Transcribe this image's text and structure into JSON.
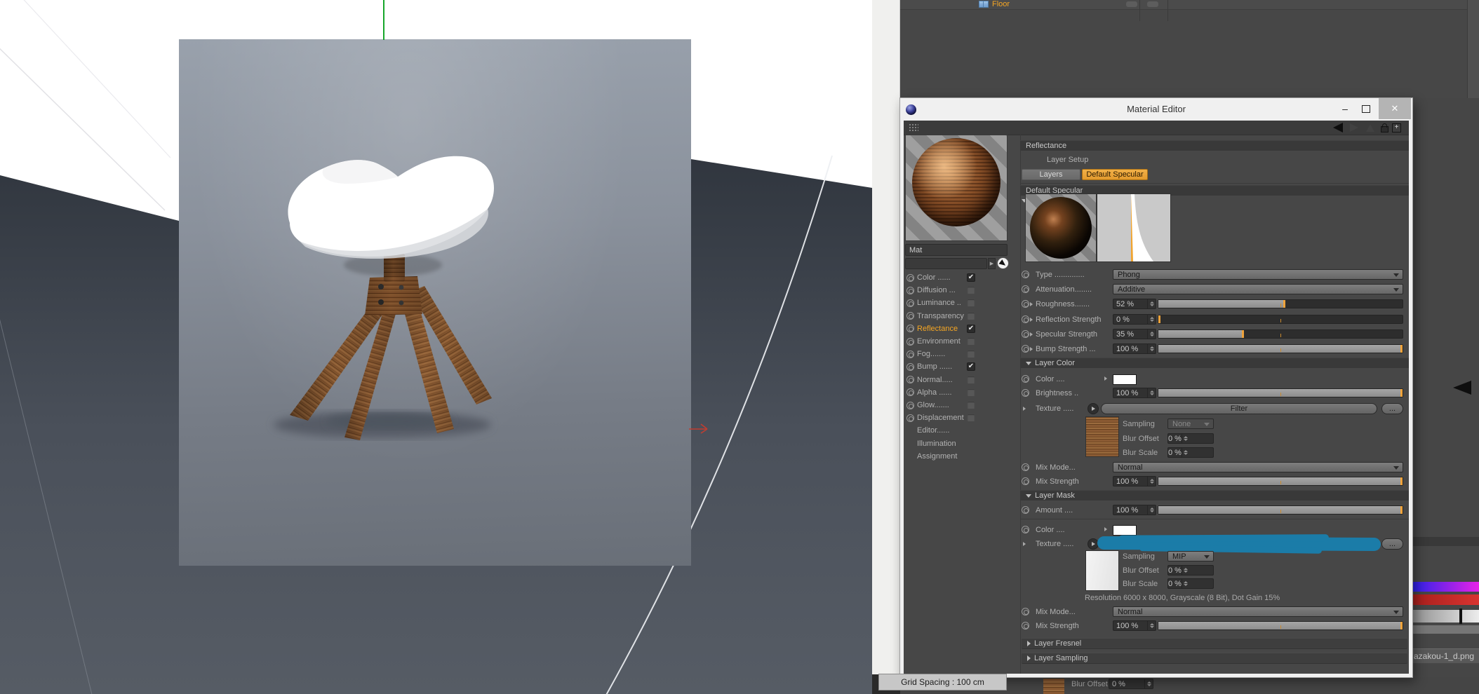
{
  "viewport": {
    "grid_spacing": "Grid Spacing : 100 cm"
  },
  "object_manager": {
    "item_label": "Floor"
  },
  "behind_window": {
    "texture_file": "azakou-1_d.png",
    "blur_offset_label": "Blur Offset",
    "blur_offset_value": "0 %"
  },
  "icons": {
    "close": "✕",
    "minimize": "—",
    "plus": "+",
    "check": "✔"
  },
  "window": {
    "title": "Material Editor",
    "material_name": "Mat",
    "channels": [
      {
        "label": "Color ......",
        "state": "checked"
      },
      {
        "label": "Diffusion ...",
        "state": "unchecked"
      },
      {
        "label": "Luminance ..",
        "state": "unchecked"
      },
      {
        "label": "Transparency",
        "state": "unchecked"
      },
      {
        "label": "Reflectance",
        "state": "checked",
        "active": true
      },
      {
        "label": "Environment",
        "state": "unchecked"
      },
      {
        "label": "Fog.......",
        "state": "unchecked"
      },
      {
        "label": "Bump ......",
        "state": "checked"
      },
      {
        "label": "Normal.....",
        "state": "unchecked"
      },
      {
        "label": "Alpha ......",
        "state": "unchecked"
      },
      {
        "label": "Glow.......",
        "state": "unchecked"
      },
      {
        "label": "Displacement",
        "state": "unchecked"
      },
      {
        "label": "Editor......",
        "state": "none"
      },
      {
        "label": "Illumination",
        "state": "none"
      },
      {
        "label": "Assignment",
        "state": "none"
      }
    ],
    "reflectance": {
      "panel_title": "Reflectance",
      "layer_setup_label": "Layer Setup",
      "tab_layers": "Layers",
      "tab_default_specular": "Default Specular",
      "section_title": "Default Specular",
      "type_label": "Type ..............",
      "type_value": "Phong",
      "attenuation_label": "Attenuation........",
      "attenuation_value": "Additive",
      "roughness_label": "Roughness.......",
      "roughness_value": "52 %",
      "roughness_fill": 52,
      "reflection_strength_label": "Reflection Strength",
      "reflection_strength_value": "0 %",
      "reflection_strength_fill": 0,
      "specular_strength_label": "Specular Strength",
      "specular_strength_value": "35 %",
      "specular_strength_fill": 35,
      "bump_strength_label": "Bump Strength ...",
      "bump_strength_value": "100 %",
      "bump_strength_fill": 100,
      "layer_color": {
        "header": "Layer Color",
        "color_label": "Color ....",
        "brightness_label": "Brightness ..",
        "brightness_value": "100 %",
        "brightness_fill": 100,
        "texture_label": "Texture .....",
        "filter_button": "Filter",
        "browse_button": "...",
        "sampling_label": "Sampling",
        "sampling_value": "None",
        "blur_offset_label": "Blur Offset",
        "blur_offset_value": "0 %",
        "blur_scale_label": "Blur Scale",
        "blur_scale_value": "0 %",
        "mix_mode_label": "Mix Mode...",
        "mix_mode_value": "Normal",
        "mix_strength_label": "Mix Strength",
        "mix_strength_value": "100 %",
        "mix_strength_fill": 100
      },
      "layer_mask": {
        "header": "Layer Mask",
        "amount_label": "Amount ....",
        "amount_value": "100 %",
        "amount_fill": 100,
        "color_label": "Color ....",
        "texture_label": "Texture .....",
        "browse_button": "...",
        "sampling_label": "Sampling",
        "sampling_value": "MIP",
        "blur_offset_label": "Blur Offset",
        "blur_offset_value": "0 %",
        "blur_scale_label": "Blur Scale",
        "blur_scale_value": "0 %",
        "resolution_info": "Resolution 6000 x 8000, Grayscale (8 Bit), Dot Gain 15%",
        "mix_mode_label": "Mix Mode...",
        "mix_mode_value": "Normal",
        "mix_strength_label": "Mix Strength",
        "mix_strength_value": "100 %",
        "mix_strength_fill": 100
      },
      "collapsed_sections": [
        "Layer Fresnel",
        "Layer Sampling"
      ]
    }
  },
  "colors": {
    "accent_orange": "#EFA33B",
    "highlight_blue": "#1B7CA8",
    "axis_green": "#17A62B",
    "selected_text_orange": "#F5A623"
  }
}
